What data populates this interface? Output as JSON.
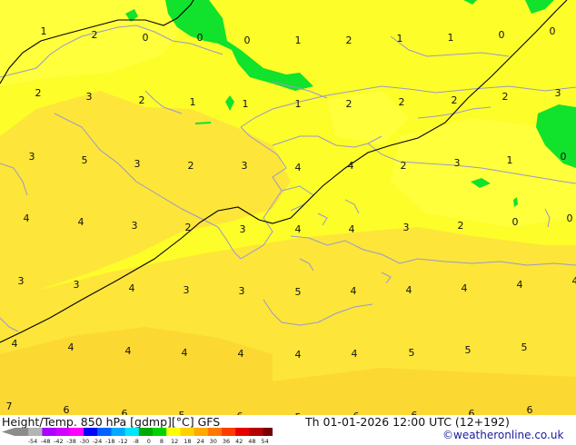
{
  "map": {
    "field": "temperature_850hPa",
    "colors": {
      "base": "#fdfd2a",
      "light": "#ffff3c",
      "orange_light": "#fde53a",
      "orange": "#fcd832",
      "green": "#11e22b",
      "coast": "#9999cc",
      "isoline": "#000000"
    },
    "values": [
      {
        "t": "1"
      },
      {
        "t": "2"
      },
      {
        "t": "0"
      },
      {
        "t": "0"
      },
      {
        "t": "0"
      },
      {
        "t": "1"
      },
      {
        "t": "2"
      },
      {
        "t": "1"
      },
      {
        "t": "1"
      },
      {
        "t": "0"
      },
      {
        "t": "0"
      },
      {
        "t": "2"
      },
      {
        "t": "3"
      },
      {
        "t": "2"
      },
      {
        "t": "1"
      },
      {
        "t": "1"
      },
      {
        "t": "1"
      },
      {
        "t": "2"
      },
      {
        "t": "2"
      },
      {
        "t": "2"
      },
      {
        "t": "2"
      },
      {
        "t": "3"
      },
      {
        "t": "3"
      },
      {
        "t": "5"
      },
      {
        "t": "3"
      },
      {
        "t": "2"
      },
      {
        "t": "3"
      },
      {
        "t": "4"
      },
      {
        "t": "4"
      },
      {
        "t": "2"
      },
      {
        "t": "3"
      },
      {
        "t": "1"
      },
      {
        "t": "0"
      },
      {
        "t": "4"
      },
      {
        "t": "4"
      },
      {
        "t": "3"
      },
      {
        "t": "2"
      },
      {
        "t": "3"
      },
      {
        "t": "4"
      },
      {
        "t": "4"
      },
      {
        "t": "3"
      },
      {
        "t": "2"
      },
      {
        "t": "0"
      },
      {
        "t": "0"
      },
      {
        "t": "3"
      },
      {
        "t": "3"
      },
      {
        "t": "4"
      },
      {
        "t": "3"
      },
      {
        "t": "3"
      },
      {
        "t": "5"
      },
      {
        "t": "4"
      },
      {
        "t": "4"
      },
      {
        "t": "4"
      },
      {
        "t": "4"
      },
      {
        "t": "4"
      },
      {
        "t": "4"
      },
      {
        "t": "4"
      },
      {
        "t": "4"
      },
      {
        "t": "4"
      },
      {
        "t": "4"
      },
      {
        "t": "4"
      },
      {
        "t": "4"
      },
      {
        "t": "5"
      },
      {
        "t": "5"
      },
      {
        "t": "5"
      },
      {
        "t": "7"
      },
      {
        "t": "6"
      },
      {
        "t": "6"
      },
      {
        "t": "5"
      },
      {
        "t": "6"
      },
      {
        "t": "5"
      },
      {
        "t": "6"
      },
      {
        "t": "6"
      },
      {
        "t": "6"
      },
      {
        "t": "6"
      }
    ]
  },
  "footer": {
    "title": "Height/Temp. 850 hPa [gdmp][°C] GFS",
    "datetime": "Th 01-01-2026 12:00 UTC (12+192)",
    "credit": "©weatheronline.co.uk"
  },
  "colorbar": {
    "labels": [
      "-54",
      "-48",
      "-42",
      "-38",
      "-30",
      "-24",
      "-18",
      "-12",
      "-8",
      "0",
      "8",
      "12",
      "18",
      "24",
      "30",
      "36",
      "42",
      "48",
      "54"
    ],
    "colors": [
      "#8c8c8c",
      "#b4b4b4",
      "#aa00ff",
      "#d200ff",
      "#ff00ff",
      "#0000ff",
      "#0064ff",
      "#00aaff",
      "#00e6ff",
      "#00aa00",
      "#00d200",
      "#ffff00",
      "#ffd200",
      "#ffaa00",
      "#ff7800",
      "#ff3c00",
      "#e60000",
      "#b40000",
      "#780000"
    ]
  }
}
